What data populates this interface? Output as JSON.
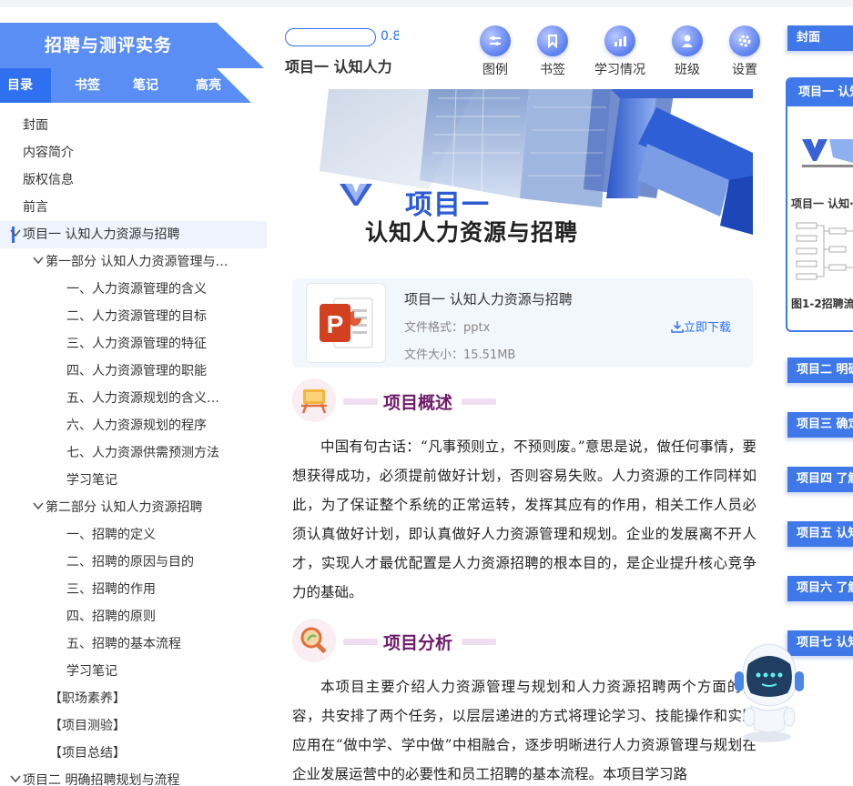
{
  "sidebar": {
    "book_title": "招聘与测评实务",
    "tabs": [
      "目录",
      "书签",
      "笔记",
      "高亮"
    ],
    "toc": [
      {
        "label": "封面",
        "level": 0,
        "caret": false
      },
      {
        "label": "内容简介",
        "level": 0,
        "caret": false
      },
      {
        "label": "版权信息",
        "level": 0,
        "caret": false
      },
      {
        "label": "前言",
        "level": 0,
        "caret": false
      },
      {
        "label": "项目一 认知人力资源与招聘",
        "level": 0,
        "caret": true,
        "active": true
      },
      {
        "label": "第一部分 认知人力资源管理与…",
        "level": 1,
        "caret": true
      },
      {
        "label": "一、人力资源管理的含义",
        "level": 2,
        "caret": false
      },
      {
        "label": "二、人力资源管理的目标",
        "level": 2,
        "caret": false
      },
      {
        "label": "三、人力资源管理的特征",
        "level": 2,
        "caret": false
      },
      {
        "label": "四、人力资源管理的职能",
        "level": 2,
        "caret": false
      },
      {
        "label": "五、人力资源规划的含义…",
        "level": 2,
        "caret": false
      },
      {
        "label": "六、人力资源规划的程序",
        "level": 2,
        "caret": false
      },
      {
        "label": "七、人力资源供需预测方法",
        "level": 2,
        "caret": false
      },
      {
        "label": "学习笔记",
        "level": 2,
        "caret": false
      },
      {
        "label": "第二部分 认知人力资源招聘",
        "level": 1,
        "caret": true
      },
      {
        "label": "一、招聘的定义",
        "level": 2,
        "caret": false
      },
      {
        "label": "二、招聘的原因与目的",
        "level": 2,
        "caret": false
      },
      {
        "label": "三、招聘的作用",
        "level": 2,
        "caret": false
      },
      {
        "label": "四、招聘的原则",
        "level": 2,
        "caret": false
      },
      {
        "label": "五、招聘的基本流程",
        "level": 2,
        "caret": false
      },
      {
        "label": "学习笔记",
        "level": 2,
        "caret": false
      },
      {
        "label": "【职场素养】",
        "level": 1.5,
        "caret": false
      },
      {
        "label": "【项目测验】",
        "level": 1.5,
        "caret": false
      },
      {
        "label": "【项目总结】",
        "level": 1.5,
        "caret": false
      },
      {
        "label": "项目二 明确招聘规划与流程",
        "level": 0,
        "caret": true
      }
    ]
  },
  "header": {
    "progress": 0.0,
    "progress_text": "0.8",
    "chapter_title": "项目一 认知人力",
    "buttons": [
      {
        "label": "图例",
        "icon": "legend-icon"
      },
      {
        "label": "书签",
        "icon": "bookmark-icon"
      },
      {
        "label": "学习情况",
        "icon": "chart-icon"
      },
      {
        "label": "班级",
        "icon": "user-icon"
      },
      {
        "label": "设置",
        "icon": "gear-icon"
      }
    ]
  },
  "banner": {
    "project": "项目一",
    "subtitle": "认知人力资源与招聘"
  },
  "file": {
    "name": "项目一 认知人力资源与招聘",
    "format": "文件格式：pptx",
    "size": "文件大小：15.51MB",
    "download": "立即下载"
  },
  "sections": [
    {
      "title": "项目概述",
      "icon": "easel-icon",
      "text": "中国有句古话：“凡事预则立，不预则废。”意思是说，做任何事情，要想获得成功，必须提前做好计划，否则容易失败。人力资源的工作同样如此，为了保证整个系统的正常运转，发挥其应有的作用，相关工作人员必须认真做好计划，即认真做好人力资源管理和规划。企业的发展离不开人才，实现人才最优配置是人力资源招聘的根本目的，是企业提升核心竞争力的基础。"
    },
    {
      "title": "项目分析",
      "icon": "magnifier-icon",
      "text": "本项目主要介绍人力资源管理与规划和人力资源招聘两个方面的内容，共安排了两个任务，以层层递进的方式将理论学习、技能操作和实践应用在“做中学、学中做”中相融合，逐步明晰进行人力资源管理与规划在企业发展运营中的必要性和员工招聘的基本流程。本项目学习路"
    }
  ],
  "rail": {
    "cover": "封面",
    "card_head": "项目一 认知",
    "card_line1": "项目一 认知·",
    "card_line2": "图1-2招聘流",
    "items": [
      "项目二 明确",
      "项目三 确定",
      "项目四 了解",
      "项目五 认知",
      "项目六 了解",
      "项目七 认知"
    ]
  },
  "colors": {
    "accent": "#2e70f0",
    "title_bar": "#5b8ef5",
    "section_title": "#6e1a6a"
  }
}
